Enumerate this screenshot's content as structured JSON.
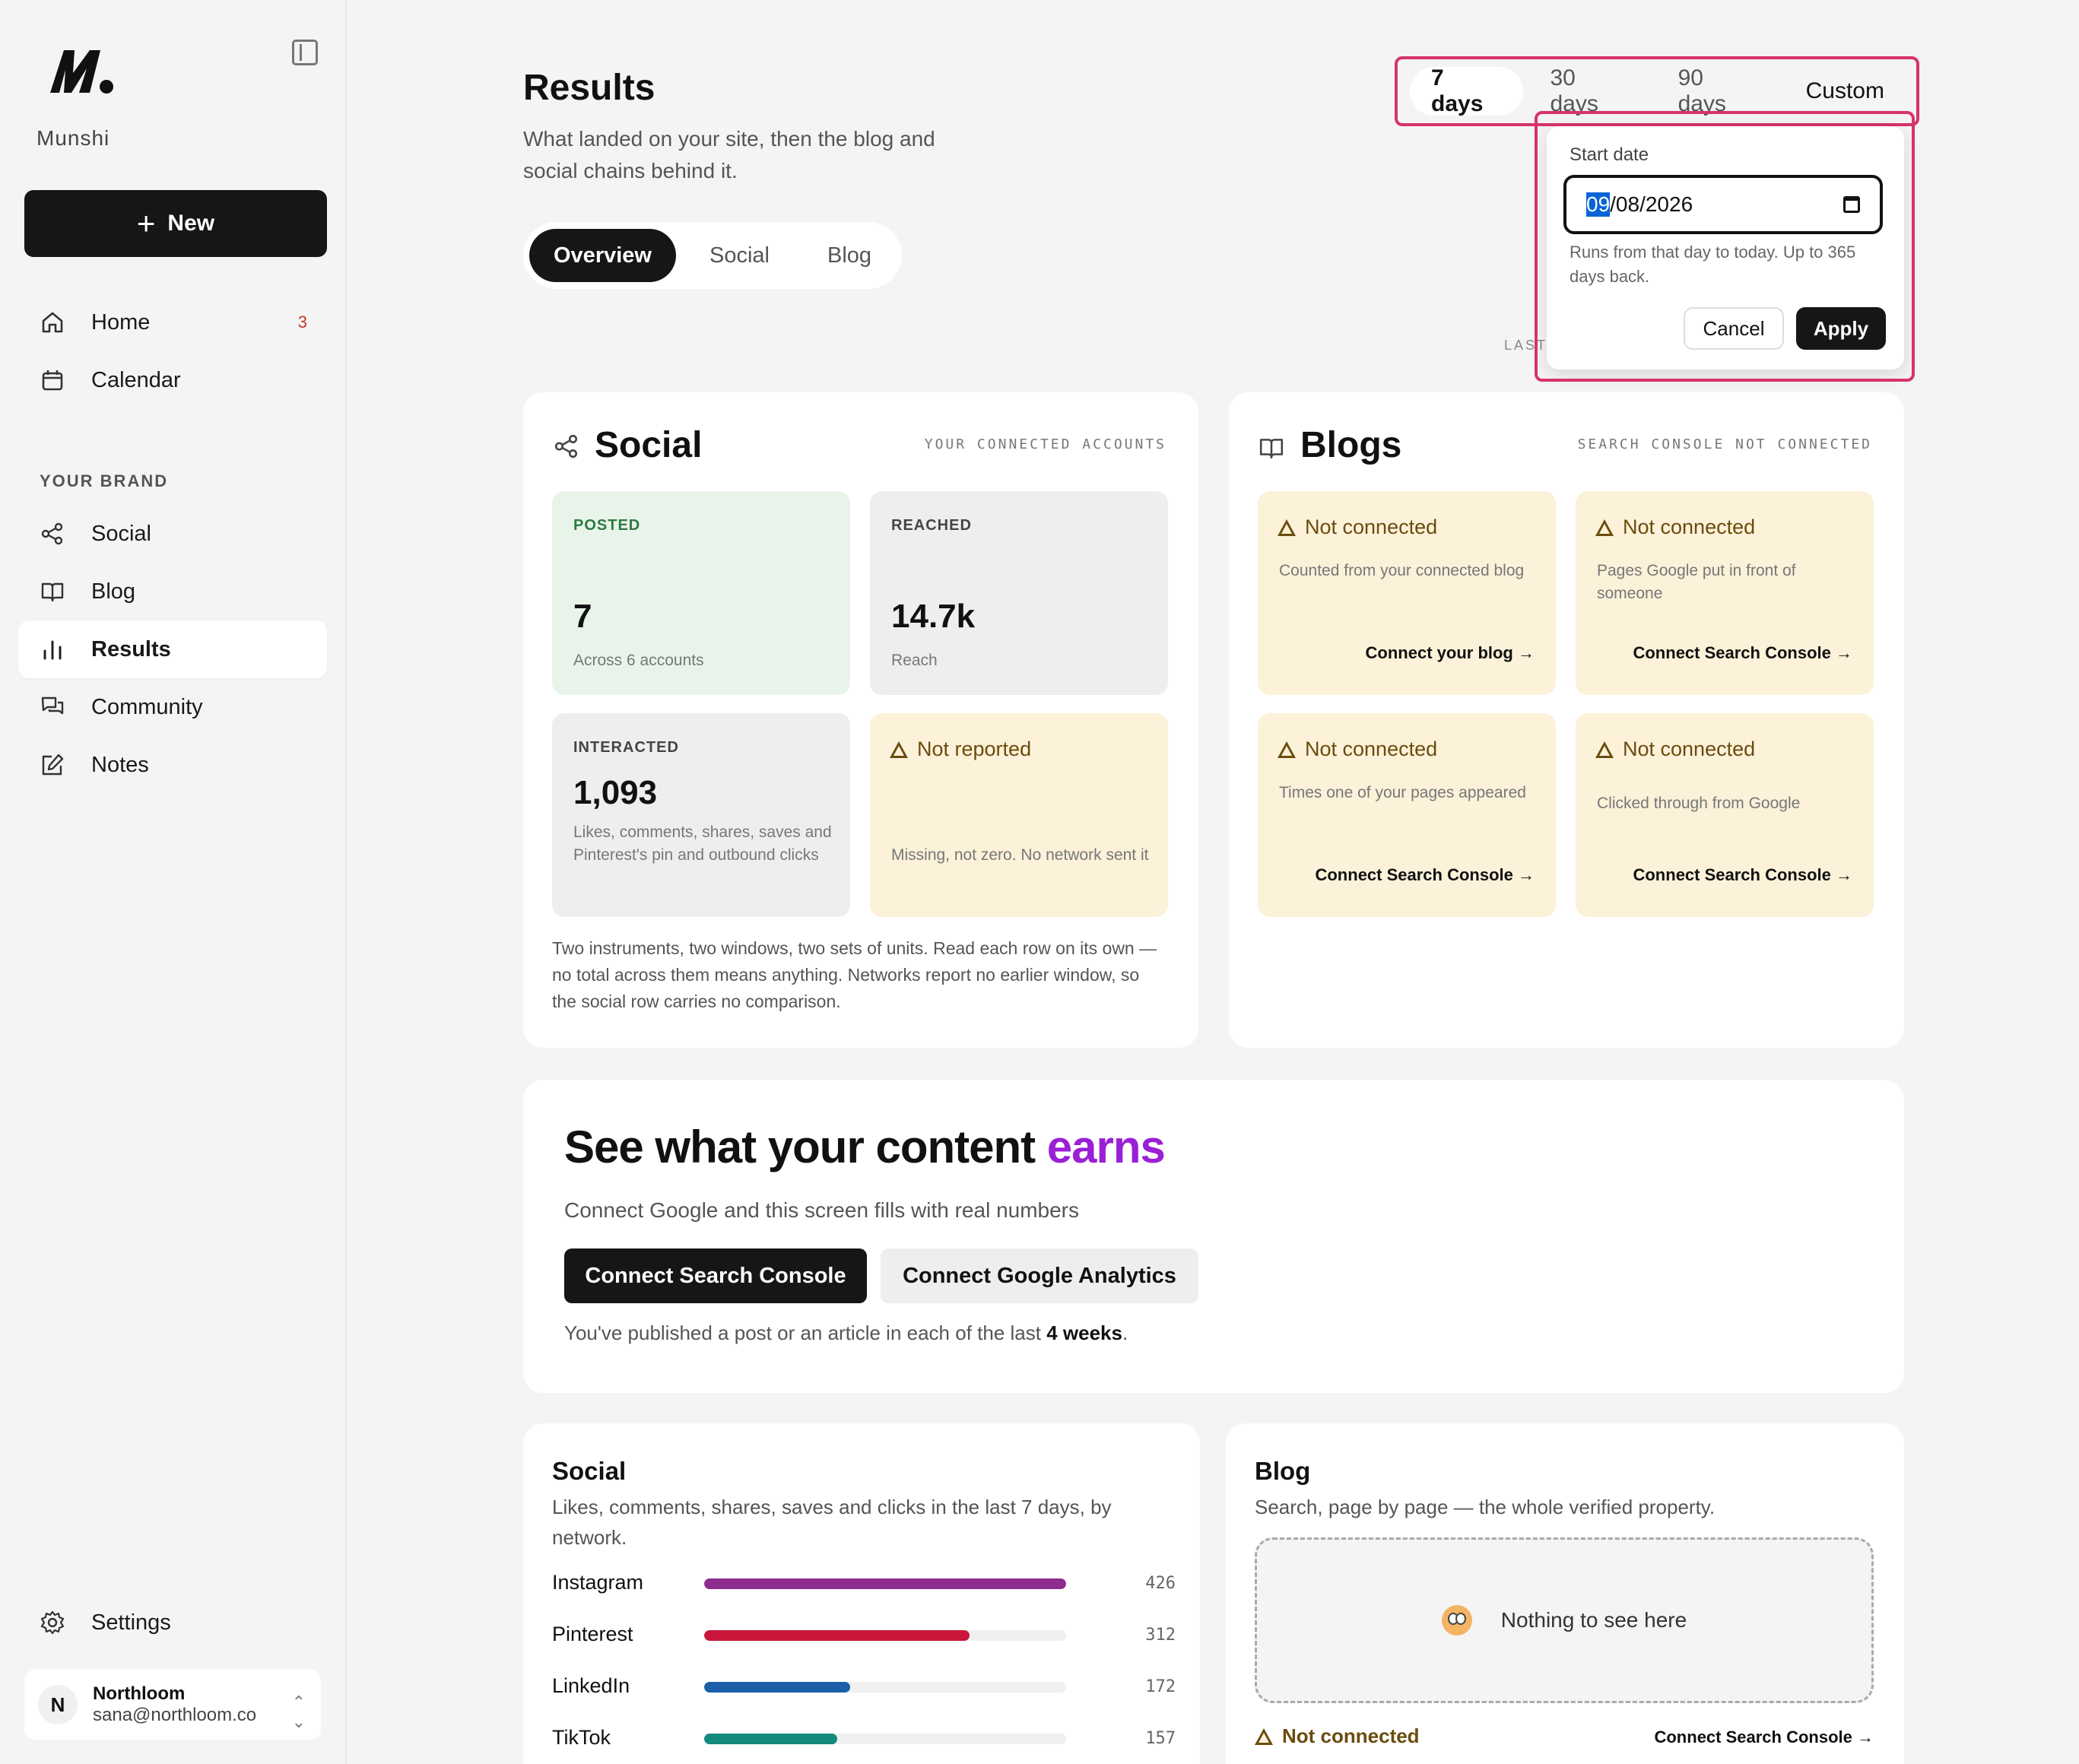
{
  "sidebar": {
    "brand": "Munshi",
    "new_label": "New",
    "nav": [
      {
        "label": "Home",
        "badge": "3"
      },
      {
        "label": "Calendar"
      }
    ],
    "section_label": "YOUR BRAND",
    "brand_nav": [
      {
        "label": "Social"
      },
      {
        "label": "Blog"
      },
      {
        "label": "Results"
      },
      {
        "label": "Community"
      },
      {
        "label": "Notes"
      }
    ],
    "settings_label": "Settings",
    "account": {
      "initial": "N",
      "name": "Northloom",
      "email": "sana@northloom.co"
    }
  },
  "header": {
    "title": "Results",
    "subtitle": "What landed on your site, then the blog and social chains behind it.",
    "view_tabs": [
      "Overview",
      "Social",
      "Blog"
    ],
    "range_tabs": [
      "7 days",
      "30 days",
      "90 days",
      "Custom"
    ],
    "last_label": "LAST"
  },
  "date_popover": {
    "label": "Start date",
    "value_month": "09",
    "value_rest": "/08/2026",
    "help": "Runs from that day to today. Up to 365 days back.",
    "cancel": "Cancel",
    "apply": "Apply"
  },
  "social_card": {
    "title": "Social",
    "meta": "YOUR CONNECTED ACCOUNTS",
    "posted": {
      "label": "POSTED",
      "value": "7",
      "desc": "Across 6 accounts"
    },
    "reached": {
      "label": "REACHED",
      "value": "14.7k",
      "desc": "Reach"
    },
    "interacted": {
      "label": "INTERACTED",
      "value": "1,093",
      "desc": "Likes, comments, shares, saves and Pinterest's pin and outbound clicks"
    },
    "not_reported": {
      "title": "Not reported",
      "desc": "Missing, not zero. No network sent it"
    },
    "footnote": "Two instruments, two windows, two sets of units. Read each row on its own — no total across them means anything. Networks report no earlier window, so the social row carries no comparison."
  },
  "blogs_card": {
    "title": "Blogs",
    "meta": "SEARCH CONSOLE NOT CONNECTED",
    "tiles": [
      {
        "title": "Not connected",
        "desc": "Counted from your connected blog",
        "link": "Connect your blog →"
      },
      {
        "title": "Not connected",
        "desc": "Pages Google put in front of someone",
        "link": "Connect Search Console →"
      },
      {
        "title": "Not connected",
        "desc": "Times one of your pages appeared",
        "link": "Connect Search Console →"
      },
      {
        "title": "Not connected",
        "desc": "Clicked through from Google",
        "link": "Connect Search Console →"
      }
    ]
  },
  "cta": {
    "title_main": "See what your content",
    "title_accent": "earns",
    "subtitle": "Connect Google and this screen fills with real numbers",
    "primary": "Connect Search Console",
    "secondary": "Connect Google Analytics",
    "note_prefix": "You've published a post or an article in each of the last",
    "note_bold": "4 weeks",
    "note_suffix": "."
  },
  "social_breakdown": {
    "title": "Social",
    "subtitle": "Likes, comments, shares, saves and clicks in the last 7 days, by network.",
    "rows": [
      {
        "name": "Instagram",
        "value": 426,
        "display": "426",
        "color": "#8e2b8e"
      },
      {
        "name": "Pinterest",
        "value": 312,
        "display": "312",
        "color": "#c8173a"
      },
      {
        "name": "LinkedIn",
        "value": 172,
        "display": "172",
        "color": "#1a5fa8"
      },
      {
        "name": "TikTok",
        "value": 157,
        "display": "157",
        "color": "#138a7c"
      }
    ],
    "max": 426
  },
  "blog_breakdown": {
    "title": "Blog",
    "subtitle": "Search, page by page — the whole verified property.",
    "empty": "Nothing to see here",
    "status": "Not connected",
    "link": "Connect Search Console →"
  },
  "colors": {
    "accent": "#9b1fd6",
    "highlight": "#d6336c",
    "warning_bg": "#fcf1d9",
    "success_bg": "#e8f4ea"
  }
}
